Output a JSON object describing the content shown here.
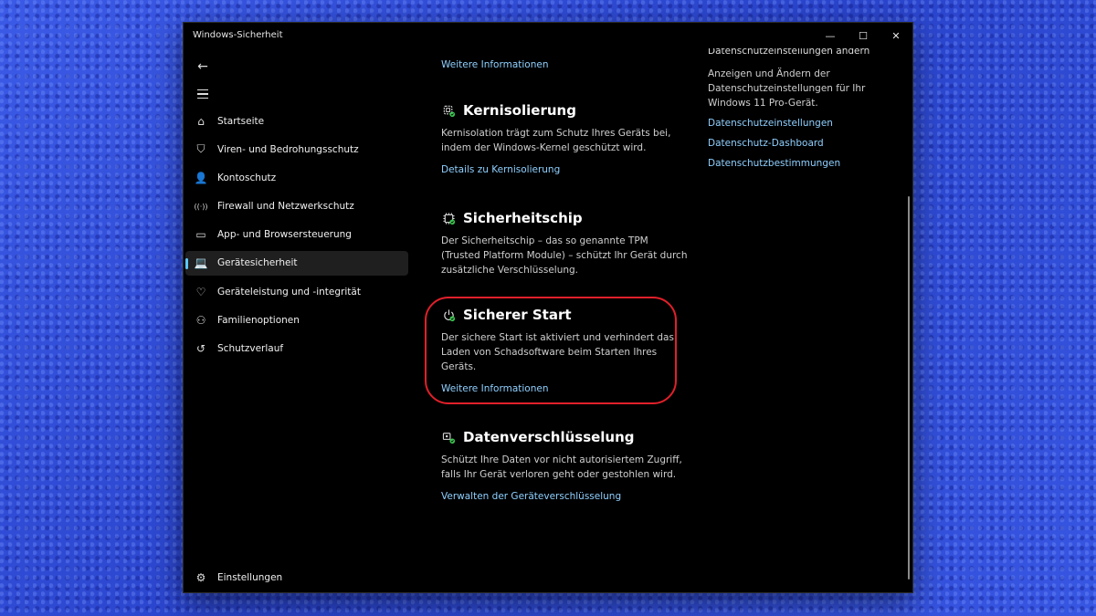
{
  "window": {
    "title": "Windows-Sicherheit",
    "controls": {
      "minimize": "—",
      "maximize": "☐",
      "close": "✕"
    }
  },
  "nav": {
    "back_icon": "←",
    "items": [
      {
        "label": "Startseite",
        "icon": "home-icon",
        "glyph": "⌂"
      },
      {
        "label": "Viren- und Bedrohungsschutz",
        "icon": "shield-icon",
        "glyph": "⛉"
      },
      {
        "label": "Kontoschutz",
        "icon": "person-icon",
        "glyph": "👤"
      },
      {
        "label": "Firewall und Netzwerkschutz",
        "icon": "wifi-icon",
        "glyph": "((·))"
      },
      {
        "label": "App- und Browsersteuerung",
        "icon": "app-window-icon",
        "glyph": "▭"
      },
      {
        "label": "Gerätesicherheit",
        "icon": "laptop-icon",
        "glyph": "💻",
        "active": true
      },
      {
        "label": "Geräteleistung und -integrität",
        "icon": "heart-pulse-icon",
        "glyph": "♡"
      },
      {
        "label": "Familienoptionen",
        "icon": "family-icon",
        "glyph": "⚇"
      },
      {
        "label": "Schutzverlauf",
        "icon": "history-icon",
        "glyph": "↺"
      }
    ],
    "settings_label": "Einstellungen",
    "settings_glyph": "⚙"
  },
  "content": {
    "top_link": "Weitere Informationen",
    "sections": [
      {
        "title": "Kernisolierung",
        "icon": "core-isolation-icon",
        "desc": "Kernisolation trägt zum Schutz Ihres Geräts bei, indem der Windows-Kernel geschützt wird.",
        "link": "Details zu Kernisolierung"
      },
      {
        "title": "Sicherheitschip",
        "icon": "chip-icon",
        "desc": "Der Sicherheitschip – das so genannte TPM (Trusted Platform Module) – schützt Ihr Gerät durch zusätzliche Verschlüsselung.",
        "link": ""
      },
      {
        "title": "Sicherer Start",
        "icon": "power-icon",
        "desc": "Der sichere Start ist aktiviert und verhindert das Laden von Schadsoftware beim Starten Ihres Geräts.",
        "link": "Weitere Informationen"
      },
      {
        "title": "Datenverschlüsselung",
        "icon": "encryption-key-icon",
        "desc": "Schützt Ihre Daten vor nicht autorisiertem Zugriff, falls Ihr Gerät verloren geht oder gestohlen wird.",
        "link": "Verwalten der Geräteverschlüsselung"
      }
    ]
  },
  "right_panel": {
    "cut_heading": "Datenschutzeinstellungen ändern",
    "desc": "Anzeigen und Ändern der Datenschutzeinstellungen für Ihr Windows 11 Pro-Gerät.",
    "links": [
      "Datenschutzeinstellungen",
      "Datenschutz-Dashboard",
      "Datenschutzbestimmungen"
    ]
  },
  "colors": {
    "accent": "#5cc8ff",
    "link": "#8fd0ff",
    "highlight": "#e0202a",
    "status_green": "#3cc650"
  }
}
